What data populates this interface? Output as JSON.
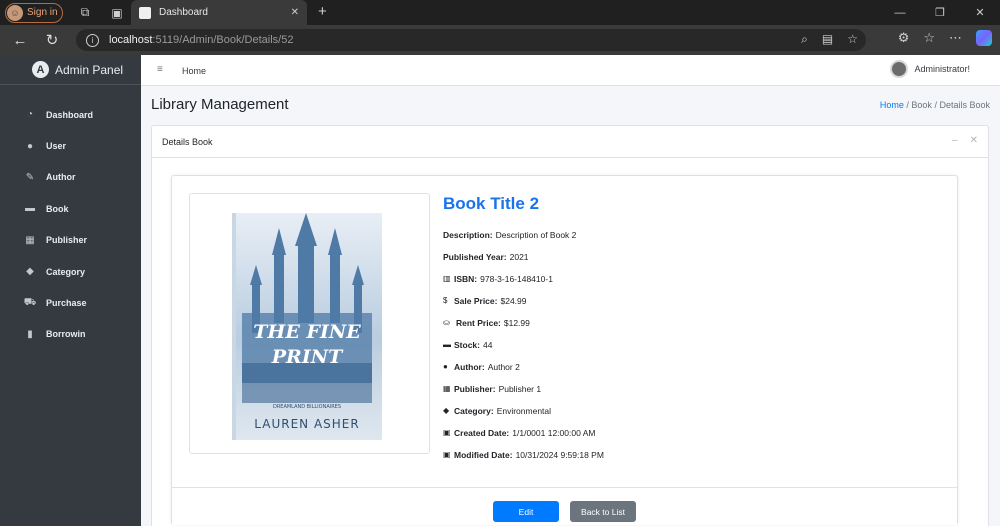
{
  "browser": {
    "profile_label": "Sign in",
    "tab_title": "Dashboard",
    "url_host": "localhost",
    "url_path": ":5119/Admin/Book/Details/52"
  },
  "sidebar": {
    "brand": "Admin Panel",
    "brand_letter": "A",
    "items": [
      {
        "label": "Dashboard",
        "icon": "gauge-icon",
        "glyph": "◔"
      },
      {
        "label": "User",
        "icon": "user-icon",
        "glyph": "●"
      },
      {
        "label": "Author",
        "icon": "pen-icon",
        "glyph": "✎"
      },
      {
        "label": "Book",
        "icon": "book-icon",
        "glyph": "▬"
      },
      {
        "label": "Publisher",
        "icon": "building-icon",
        "glyph": "▦"
      },
      {
        "label": "Category",
        "icon": "tags-icon",
        "glyph": "◆"
      },
      {
        "label": "Purchase",
        "icon": "cart-icon",
        "glyph": "⛟"
      },
      {
        "label": "Borrowin",
        "icon": "bookmark-icon",
        "glyph": "▮"
      }
    ]
  },
  "topnav": {
    "home": "Home",
    "user": "Administrator!"
  },
  "page": {
    "title": "Library Management",
    "breadcrumb": {
      "home": "Home",
      "mid": "Book",
      "current": "Details Book"
    }
  },
  "card": {
    "title": "Details Book"
  },
  "book": {
    "title": "Book Title 2",
    "cover": {
      "title_line1": "THE FINE",
      "title_line2": "PRINT",
      "series": "DREAMLAND BILLIONAIRES",
      "author": "LAUREN ASHER"
    },
    "fields": {
      "description": {
        "label": "Description:",
        "value": "Description of Book 2"
      },
      "published_year": {
        "label": "Published Year:",
        "value": "2021"
      },
      "isbn": {
        "label": "ISBN:",
        "value": "978-3-16-148410-1"
      },
      "sale_price": {
        "label": "Sale Price:",
        "value": "$24.99"
      },
      "rent_price": {
        "label": "Rent Price:",
        "value": "$12.99"
      },
      "stock": {
        "label": "Stock:",
        "value": "44"
      },
      "author": {
        "label": "Author:",
        "value": "Author 2"
      },
      "publisher": {
        "label": "Publisher:",
        "value": "Publisher 1"
      },
      "category": {
        "label": "Category:",
        "value": "Environmental"
      },
      "created_date": {
        "label": "Created Date:",
        "value": "1/1/0001 12:00:00 AM"
      },
      "modified_date": {
        "label": "Modified Date:",
        "value": "10/31/2024 9:59:18 PM"
      }
    }
  },
  "actions": {
    "edit": "Edit",
    "back": "Back to List"
  },
  "colors": {
    "sidebar_bg": "#343a40",
    "primary": "#007bff",
    "secondary": "#6c757d",
    "title_blue": "#1a73e8"
  }
}
